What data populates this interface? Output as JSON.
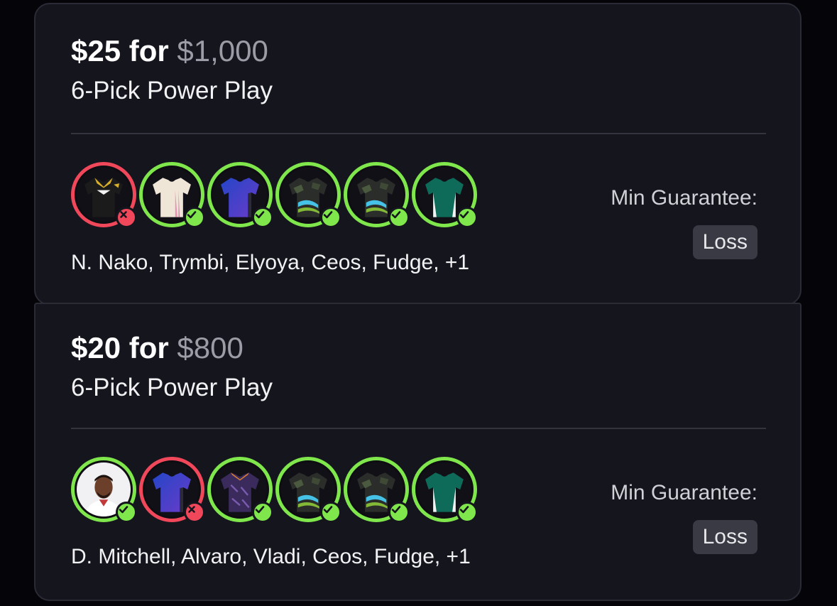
{
  "cards": [
    {
      "entry": "$25 for",
      "payout": "$1,000",
      "play_type": "6-Pick Power Play",
      "names": "N. Nako, Trymbi, Elyoya, Ceos, Fudge, +1",
      "min_guarantee_label": "Min Guarantee:",
      "min_guarantee_value": "Loss",
      "picks": [
        {
          "result": "loss",
          "jersey": "black-gold-jersey"
        },
        {
          "result": "win",
          "jersey": "cream-jersey"
        },
        {
          "result": "win",
          "jersey": "blue-purple-jersey"
        },
        {
          "result": "win",
          "jersey": "camo-blue-jersey"
        },
        {
          "result": "win",
          "jersey": "camo-blue-jersey"
        },
        {
          "result": "win",
          "jersey": "teal-jersey"
        }
      ]
    },
    {
      "entry": "$20 for",
      "payout": "$800",
      "play_type": "6-Pick Power Play",
      "names": "D. Mitchell, Alvaro, Vladi, Ceos, Fudge, +1",
      "min_guarantee_label": "Min Guarantee:",
      "min_guarantee_value": "Loss",
      "picks": [
        {
          "result": "win",
          "jersey": "player-photo"
        },
        {
          "result": "loss",
          "jersey": "blue-purple-jersey"
        },
        {
          "result": "win",
          "jersey": "purple-pattern-jersey"
        },
        {
          "result": "win",
          "jersey": "camo-blue-jersey"
        },
        {
          "result": "win",
          "jersey": "camo-blue-jersey"
        },
        {
          "result": "win",
          "jersey": "teal-jersey"
        }
      ]
    }
  ],
  "colors": {
    "win": "#7fe74b",
    "loss": "#f0485a",
    "card_bg": "#15151e",
    "page_bg": "#050509"
  }
}
